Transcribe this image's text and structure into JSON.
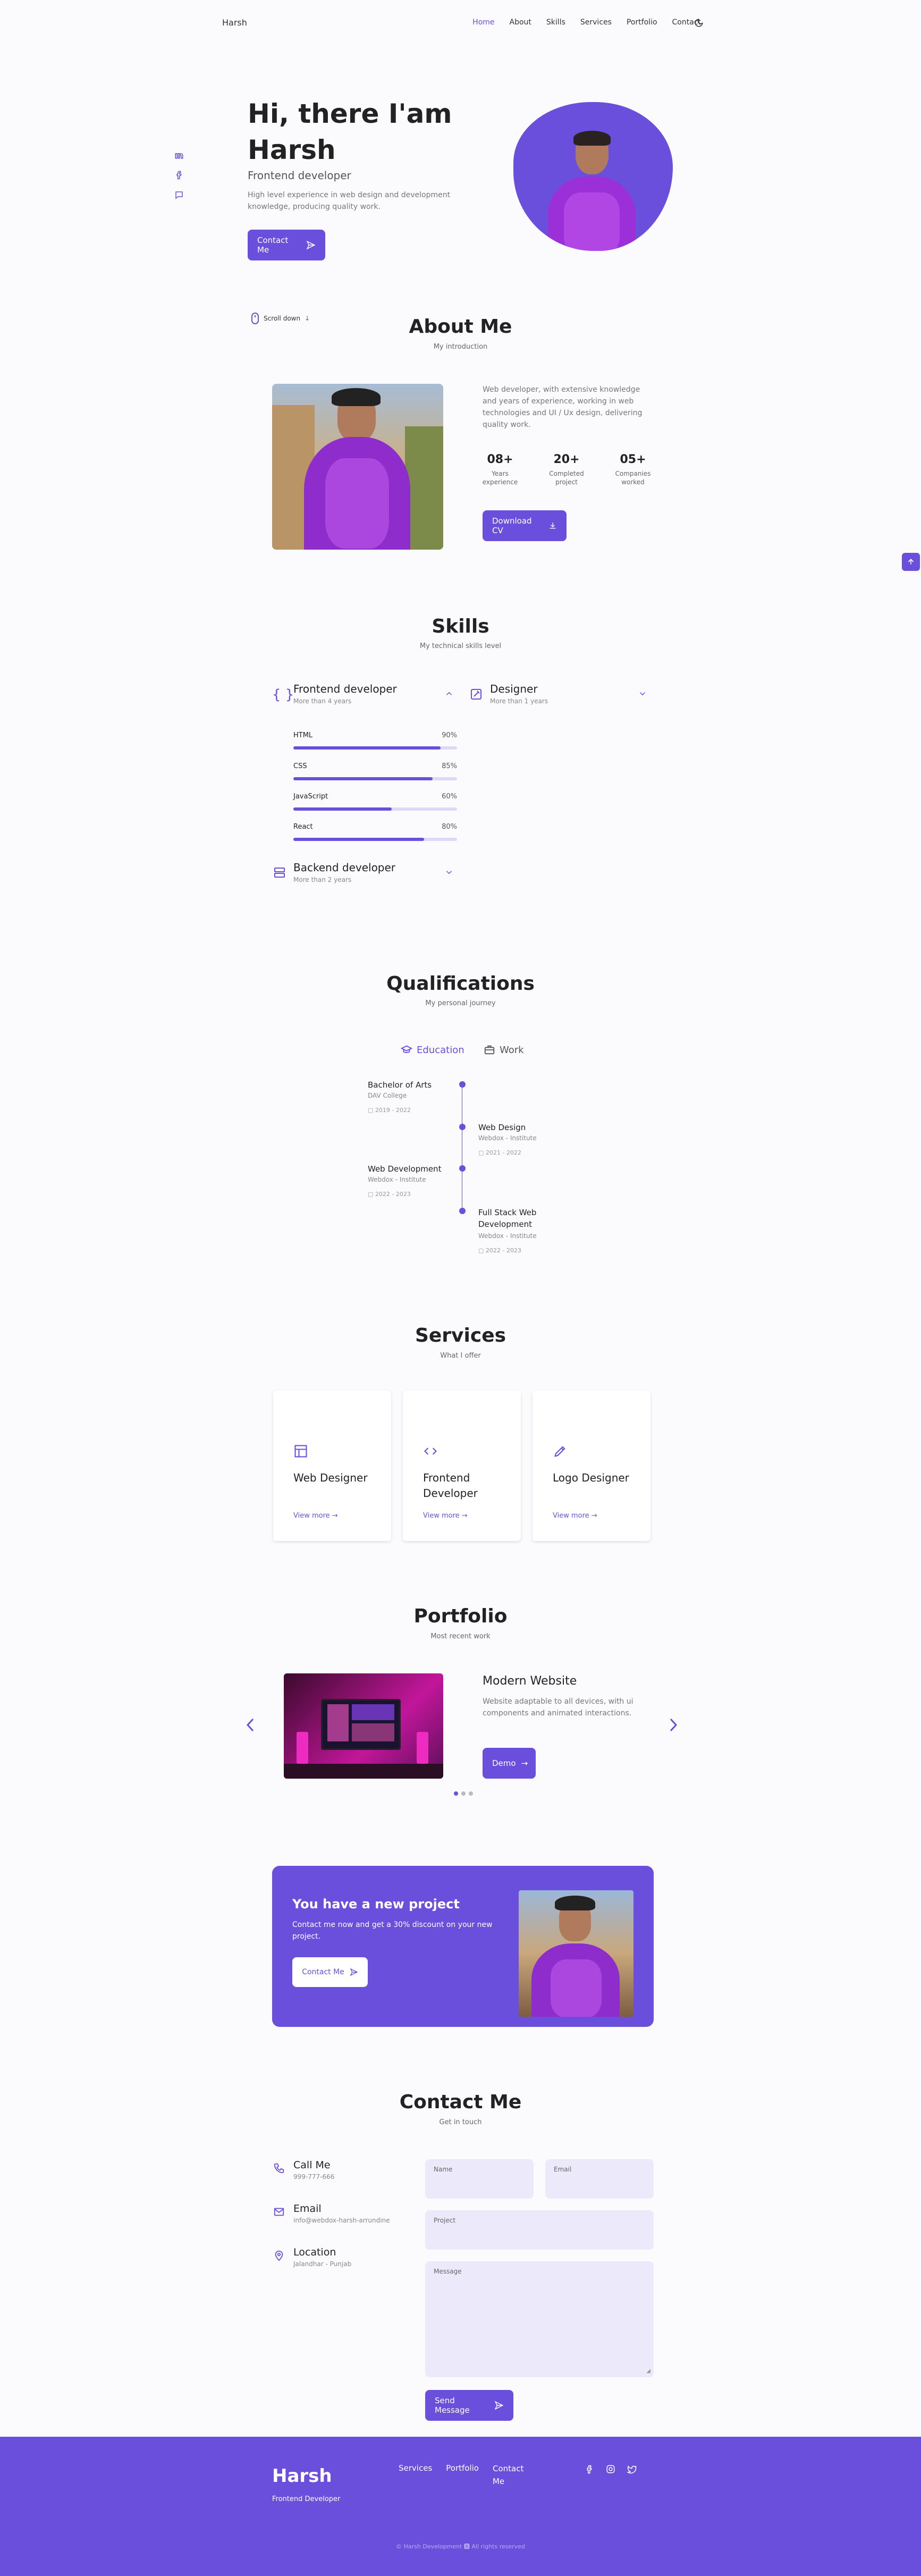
{
  "header": {
    "logo": "Harsh",
    "nav": [
      "Home",
      "About",
      "Skills",
      "Services",
      "Portfolio",
      "Contact"
    ],
    "active": "Home",
    "theme_icon": "moon-icon"
  },
  "home": {
    "title_line1": "Hi, there I'am",
    "title_line2": "Harsh",
    "subtitle": "Frontend developer",
    "description": "High level experience in web design and development knowledge, producing quality work.",
    "cta": "Contact Me",
    "scroll": "Scroll down",
    "social_icons": [
      "linkedin-icon",
      "facebook-icon",
      "chat-icon"
    ]
  },
  "about": {
    "title": "About Me",
    "subtitle": "My introduction",
    "description": "Web developer, with extensive knowledge and years of experience, working in web technologies and UI / Ux design, delivering quality work.",
    "stats": [
      {
        "value": "08+",
        "label": "Years experience"
      },
      {
        "value": "20+",
        "label": "Completed project"
      },
      {
        "value": "05+",
        "label": "Companies worked"
      }
    ],
    "download": "Download CV"
  },
  "skills": {
    "title": "Skills",
    "subtitle": "My technical skills level",
    "frontend": {
      "title": "Frontend developer",
      "sub": "More than 4 years"
    },
    "designer": {
      "title": "Designer",
      "sub": "More than 1 years"
    },
    "backend": {
      "title": "Backend developer",
      "sub": "More than 2 years"
    },
    "bars": [
      {
        "name": "HTML",
        "percent": "90%",
        "value": 0.9
      },
      {
        "name": "CSS",
        "percent": "85%",
        "value": 0.85
      },
      {
        "name": "JavaScript",
        "percent": "60%",
        "value": 0.6
      },
      {
        "name": "React",
        "percent": "80%",
        "value": 0.8
      }
    ]
  },
  "qualification": {
    "title": "Qualifications",
    "subtitle": "My personal journey",
    "tab_education": "Education",
    "tab_work": "Work",
    "items": [
      {
        "title": "Bachelor of Arts",
        "sub": "DAV College",
        "date": "2019 - 2022"
      },
      {
        "title": "Web Design",
        "sub": "Webdox - Institute",
        "date": "2021 - 2022"
      },
      {
        "title": "Web Development",
        "sub": "Webdox - Institute",
        "date": "2022 - 2023"
      },
      {
        "title": "Full Stack Web Development",
        "sub": "Webdox - Institute",
        "date": "2022 - 2023"
      }
    ]
  },
  "services": {
    "title": "Services",
    "subtitle": "What I offer",
    "cards": [
      {
        "title": "Web Designer",
        "link": "View more",
        "icon": "layout-icon"
      },
      {
        "title": "Frontend Developer",
        "link": "View more",
        "icon": "code-icon"
      },
      {
        "title": "Logo Designer",
        "link": "View more",
        "icon": "pen-icon"
      }
    ]
  },
  "portfolio": {
    "title": "Portfolio",
    "subtitle": "Most recent work",
    "project_title": "Modern Website",
    "project_desc": "Website adaptable to all devices, with ui components and animated interactions.",
    "demo": "Demo"
  },
  "project": {
    "title": "You have a new project",
    "desc": "Contact me now and get a 30% discount on your new project.",
    "cta": "Contact Me"
  },
  "contact": {
    "title": "Contact Me",
    "subtitle": "Get in touch",
    "info": [
      {
        "title": "Call Me",
        "sub": "999-777-666",
        "icon": "phone-icon"
      },
      {
        "title": "Email",
        "sub": "info@webdox-harsh-arrundine",
        "icon": "mail-icon"
      },
      {
        "title": "Location",
        "sub": "Jalandhar - Punjab",
        "icon": "map-pin-icon"
      }
    ],
    "fields": {
      "name": "Name",
      "email": "Email",
      "project": "Project",
      "message": "Message"
    },
    "send": "Send Message"
  },
  "footer": {
    "title": "Harsh",
    "sub": "Frontend Developer",
    "links": [
      "Services",
      "Portfolio",
      "Contact Me"
    ],
    "copyright": "© Harsh Development 🅱 All rights reserved",
    "colors": {
      "accent": "#6a4fdc",
      "footer_bg": "#6a4fdc"
    }
  }
}
